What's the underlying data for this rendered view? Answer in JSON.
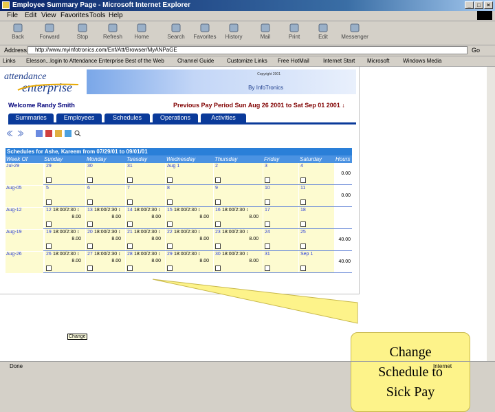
{
  "window": {
    "title": "Employee Summary Page - Microsoft Internet Explorer",
    "min": "_",
    "max": "□",
    "close": "×"
  },
  "menu": [
    "File",
    "Edit",
    "View",
    "Favorites",
    "Tools",
    "Help"
  ],
  "toolbar": [
    {
      "label": "Back",
      "icon": "back-arrow-icon"
    },
    {
      "label": "Forward",
      "icon": "forward-arrow-icon"
    },
    {
      "label": "Stop",
      "icon": "stop-icon"
    },
    {
      "label": "Refresh",
      "icon": "refresh-icon"
    },
    {
      "label": "Home",
      "icon": "home-icon"
    },
    {
      "label": "Search",
      "icon": "search-icon"
    },
    {
      "label": "Favorites",
      "icon": "favorites-icon"
    },
    {
      "label": "History",
      "icon": "history-icon"
    },
    {
      "label": "Mail",
      "icon": "mail-icon"
    },
    {
      "label": "Print",
      "icon": "print-icon"
    },
    {
      "label": "Edit",
      "icon": "edit-icon"
    },
    {
      "label": "Messenger",
      "icon": "messenger-icon"
    }
  ],
  "address": {
    "label": "Address",
    "url": "http://www.myinfotronics.com/Enf/Att/Browser/MyANPaGE",
    "go": "Go"
  },
  "links": [
    "Links",
    "Elesson...login to Attendance Enterprise",
    "Best of the Web",
    "Channel Guide",
    "Customize Links",
    "Free HotMail",
    "Internet Start",
    "Microsoft",
    "Windows Media"
  ],
  "app": {
    "logo_top": "attendance",
    "logo_bottom": "enterprise",
    "copyright": "Copyright 2001",
    "by": "By InfoTronics",
    "welcome": "Welcome Randy Smith",
    "period": "Previous Pay Period Sun Aug 26 2001 to Sat Sep 01 2001 ↓",
    "tabs": [
      "Summaries",
      "Employees",
      "Schedules",
      "Operations",
      "Activities"
    ],
    "table_title": "Schedules for Ashe, Kareem from 07/29/01 to 09/01/01",
    "columns": [
      "Week Of",
      "Sunday",
      "Monday",
      "Tuesday",
      "Wednesday",
      "Thursday",
      "Friday",
      "Saturday",
      "Hours"
    ],
    "weeks": [
      {
        "label": "Jul-29",
        "days": [
          {
            "d": "29",
            "t": "",
            "h": ""
          },
          {
            "d": "30",
            "t": "",
            "h": ""
          },
          {
            "d": "31",
            "t": "",
            "h": ""
          },
          {
            "d": "Aug 1",
            "t": "",
            "h": ""
          },
          {
            "d": "2",
            "t": "",
            "h": ""
          },
          {
            "d": "3",
            "t": "",
            "h": ""
          },
          {
            "d": "4",
            "t": "",
            "h": ""
          }
        ],
        "hours": "0.00"
      },
      {
        "label": "Aug-05",
        "days": [
          {
            "d": "5",
            "t": "",
            "h": ""
          },
          {
            "d": "6",
            "t": "",
            "h": ""
          },
          {
            "d": "7",
            "t": "",
            "h": ""
          },
          {
            "d": "8",
            "t": "",
            "h": ""
          },
          {
            "d": "9",
            "t": "",
            "h": ""
          },
          {
            "d": "10",
            "t": "",
            "h": ""
          },
          {
            "d": "11",
            "t": "",
            "h": ""
          }
        ],
        "hours": "0.00"
      },
      {
        "label": "Aug-12",
        "days": [
          {
            "d": "12",
            "t": "18:00/2:30 ↕",
            "h": "8.00"
          },
          {
            "d": "13",
            "t": "18:00/2:30 ↕",
            "h": "8.00"
          },
          {
            "d": "14",
            "t": "18:00/2:30 ↕",
            "h": "8.00"
          },
          {
            "d": "15",
            "t": "18:00/2:30 ↕",
            "h": "8.00"
          },
          {
            "d": "16",
            "t": "18:00/2:30 ↕",
            "h": "8.00"
          },
          {
            "d": "17",
            "t": "",
            "h": ""
          },
          {
            "d": "18",
            "t": "",
            "h": ""
          }
        ],
        "hours": ""
      },
      {
        "label": "Aug-19",
        "days": [
          {
            "d": "19",
            "t": "18:00/2:30 ↕",
            "h": "8.00"
          },
          {
            "d": "20",
            "t": "18:00/2:30 ↕",
            "h": "8.00"
          },
          {
            "d": "21",
            "t": "18:00/2:30 ↕",
            "h": "8.00"
          },
          {
            "d": "22",
            "t": "18:00/2:30 ↕",
            "h": "8.00"
          },
          {
            "d": "23",
            "t": "18:00/2:30 ↕",
            "h": "8.00"
          },
          {
            "d": "24",
            "t": "",
            "h": ""
          },
          {
            "d": "25",
            "t": "",
            "h": ""
          }
        ],
        "hours": "40.00"
      },
      {
        "label": "Aug-26",
        "days": [
          {
            "d": "26",
            "t": "18:00/2:30 ↕",
            "h": "8.00"
          },
          {
            "d": "27",
            "t": "18:00/2:30 ↕",
            "h": "8.00"
          },
          {
            "d": "28",
            "t": "18:00/2:30 ↕",
            "h": "8.00"
          },
          {
            "d": "29",
            "t": "18:00/2:30 ↕",
            "h": "8.00"
          },
          {
            "d": "30",
            "t": "18:00/2:30 ↕",
            "h": "8.00"
          },
          {
            "d": "31",
            "t": "",
            "h": ""
          },
          {
            "d": "Sep 1",
            "t": "",
            "h": ""
          }
        ],
        "hours": "40.00"
      }
    ],
    "tooltip": "Change"
  },
  "callout": {
    "line1": "Change",
    "line2": "Schedule to",
    "line3": "Sick Pay"
  },
  "status": {
    "left": "Done",
    "zone": "Internet"
  },
  "colors": {
    "title_bar": "#0a246a",
    "tab_blue": "#0a3a9a",
    "table_header": "#2a7fd8",
    "cell_yellow": "#fdfbd0",
    "callout": "#fdf38a",
    "period_red": "#800000"
  }
}
